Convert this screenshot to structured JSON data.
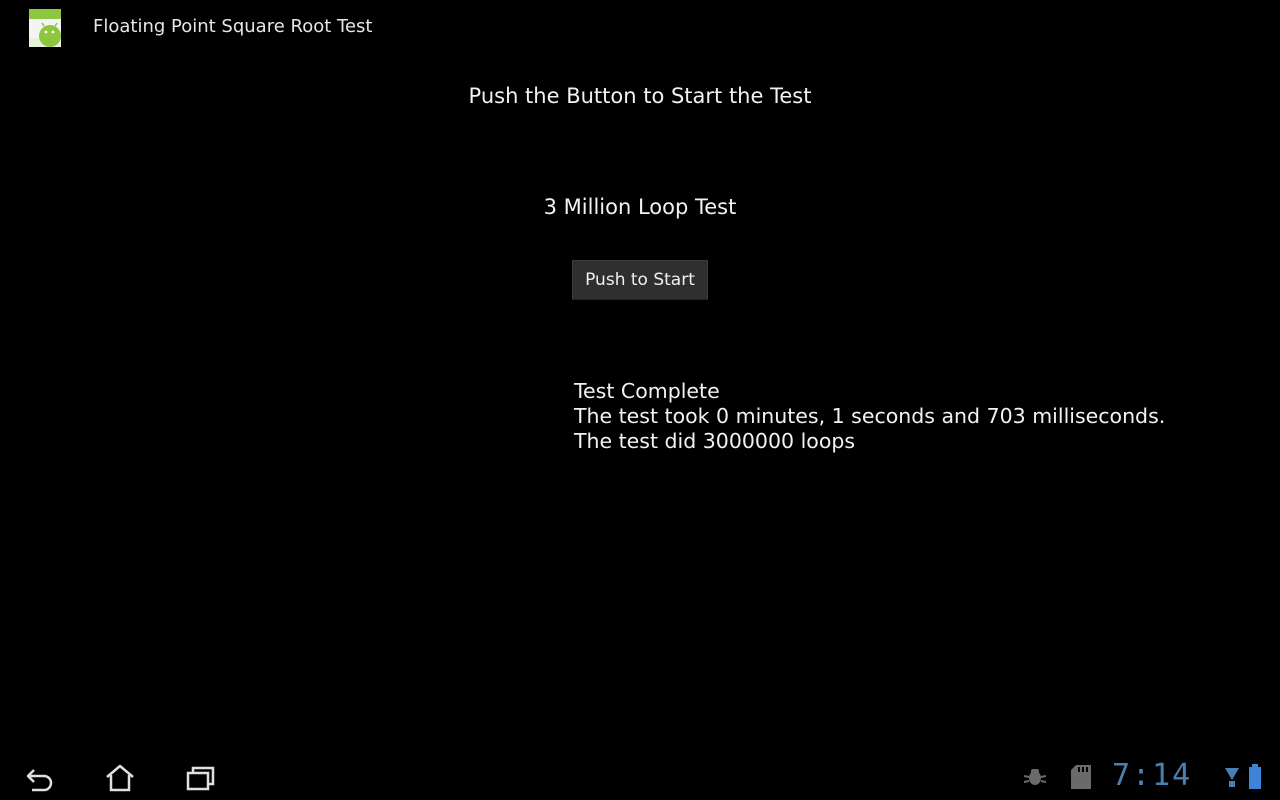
{
  "app": {
    "title": "Floating Point Square Root Test",
    "icon": "android-app-icon"
  },
  "main": {
    "instruction": "Push the Button to Start the Test",
    "loop_label": "3 Million Loop Test",
    "start_button_label": "Push to Start",
    "results": {
      "line1": "Test Complete",
      "line2": "The test took 0 minutes, 1 seconds and 703 milliseconds.",
      "line3": "The test did 3000000 loops"
    }
  },
  "system_bar": {
    "nav_icons": [
      "back-icon",
      "home-icon",
      "recent-apps-icon"
    ],
    "status_icons": [
      "usb-debugging-icon",
      "sd-card-icon",
      "signal-icon",
      "battery-icon"
    ],
    "clock": "7:14",
    "accent_color": "#4a7fb2"
  }
}
